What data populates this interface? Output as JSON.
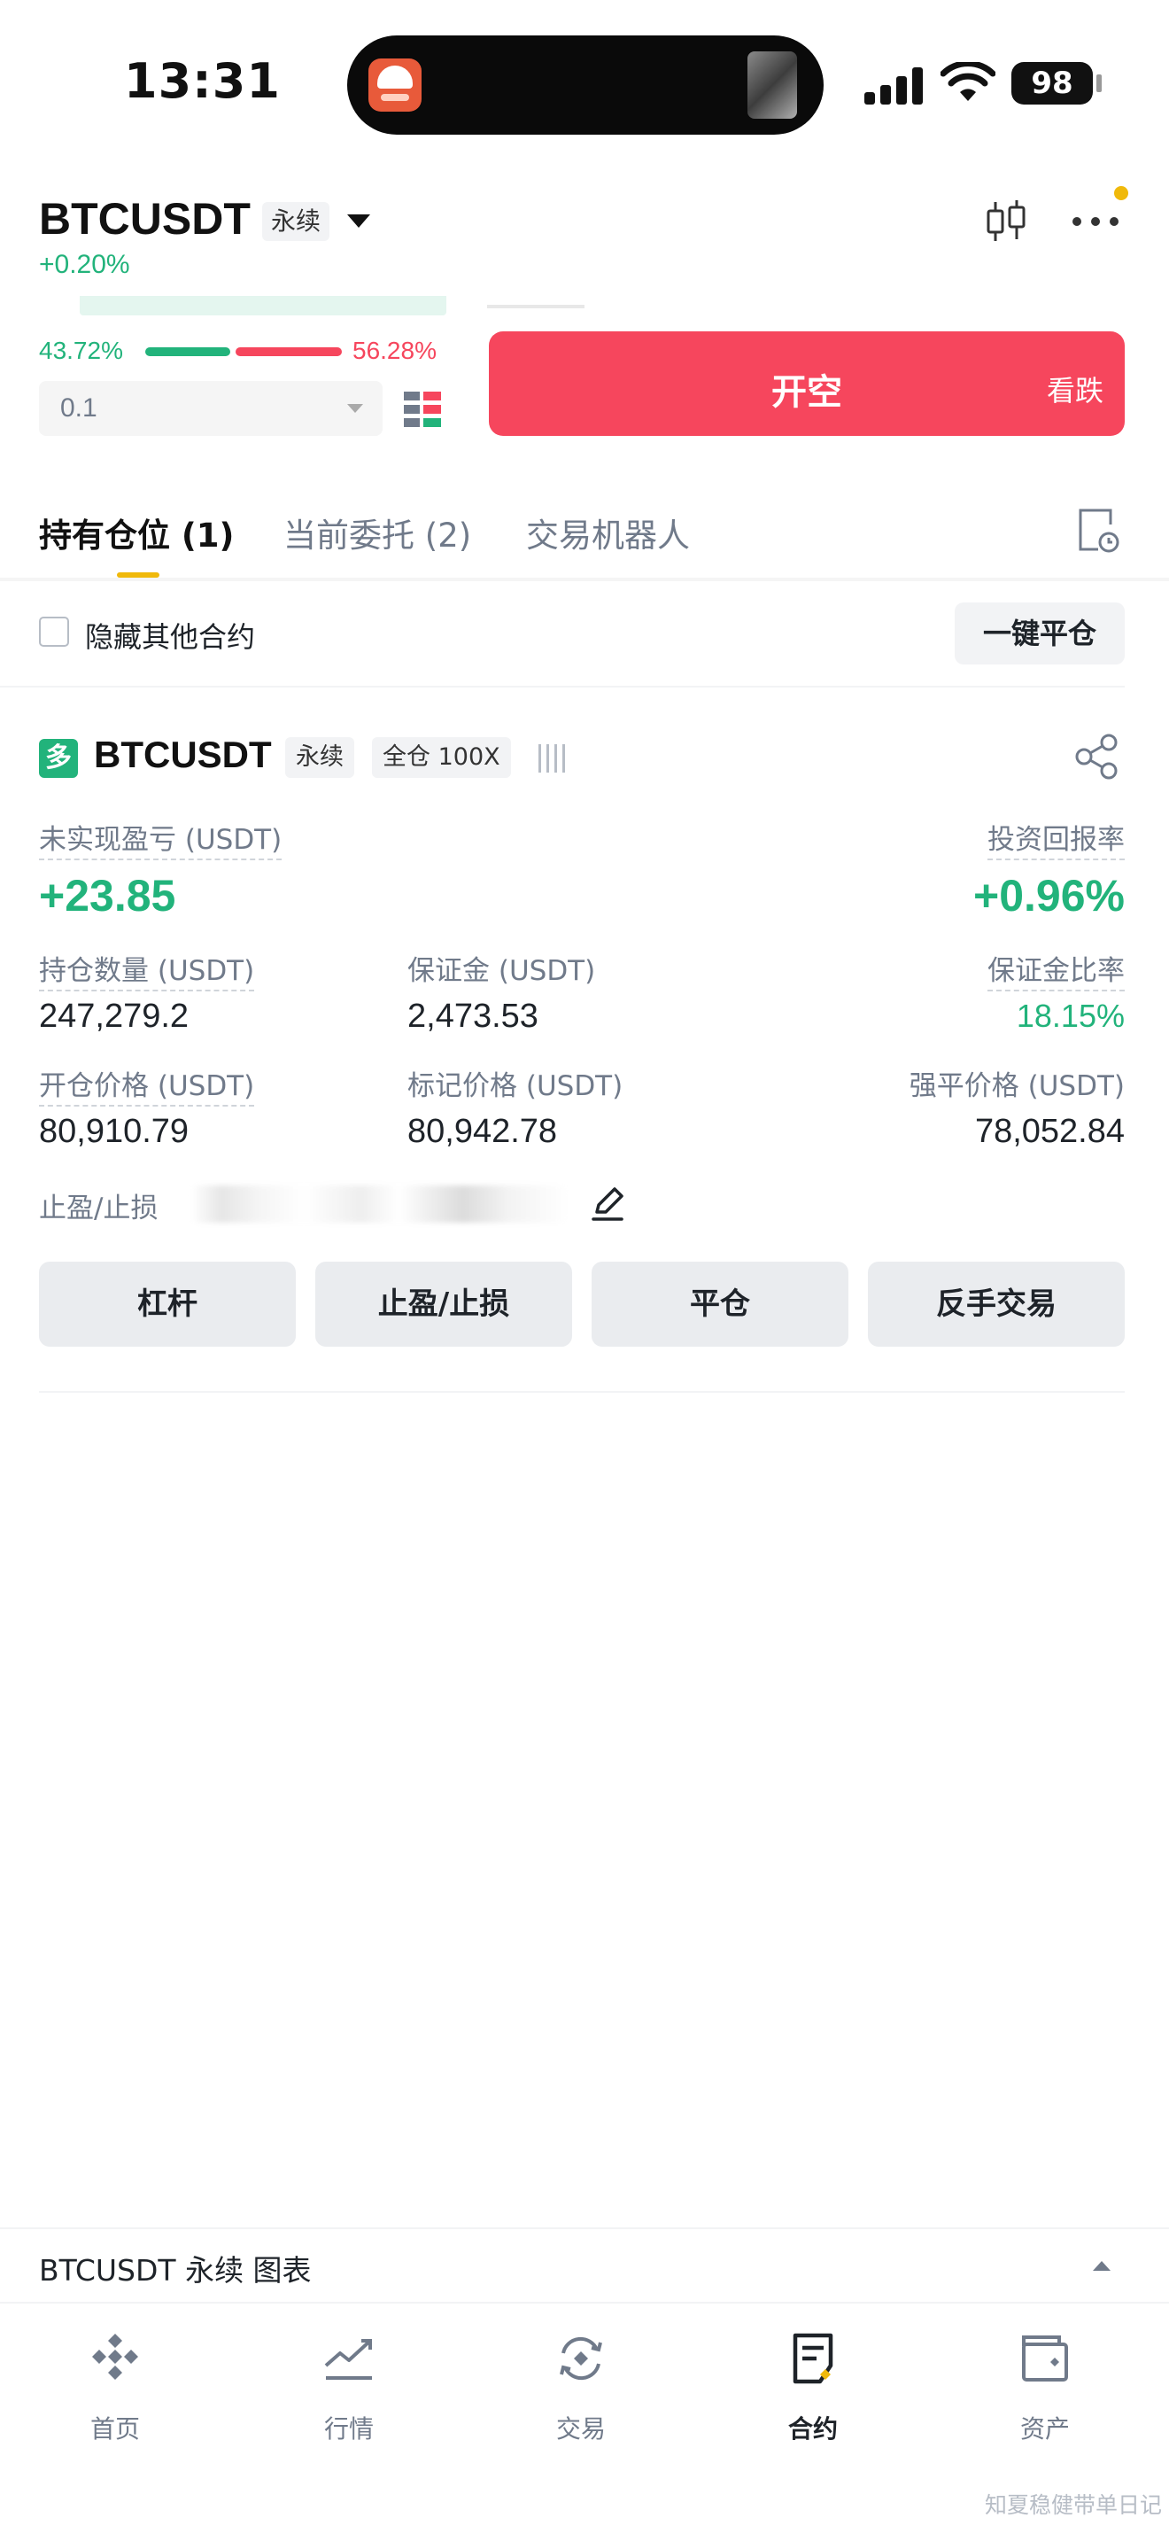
{
  "status_bar": {
    "time": "13:31",
    "battery": "98"
  },
  "header": {
    "symbol": "BTCUSDT",
    "contract_type": "永续",
    "change": "+0.20%",
    "icons": [
      "candlestick-icon",
      "more-icon"
    ],
    "notification_dot_color": "#f0b90b"
  },
  "order_panel": {
    "buy_ratio": "43.72%",
    "sell_ratio": "56.28%",
    "buy_ratio_value": 43.72,
    "sell_ratio_value": 56.28,
    "quantity": "0.1",
    "short_button": {
      "label": "开空",
      "sublabel": "看跌",
      "color": "#f6465d"
    }
  },
  "tabs": [
    {
      "label": "持有仓位",
      "count": "(1)",
      "active": true
    },
    {
      "label": "当前委托",
      "count": "(2)",
      "active": false
    },
    {
      "label": "交易机器人",
      "count": "",
      "active": false
    }
  ],
  "filter": {
    "hide_other_label": "隐藏其他合约",
    "hide_other_checked": false,
    "close_all_label": "一键平仓"
  },
  "position": {
    "side_badge": "多",
    "symbol": "BTCUSDT",
    "contract_type": "永续",
    "margin_mode": "全仓 100X",
    "unrealized_pnl_label": "未实现盈亏 (USDT)",
    "unrealized_pnl": "+23.85",
    "roi_label": "投资回报率",
    "roi": "+0.96%",
    "size_label": "持仓数量 (USDT)",
    "size": "247,279.2",
    "margin_label": "保证金 (USDT)",
    "margin": "2,473.53",
    "margin_ratio_label": "保证金比率",
    "margin_ratio": "18.15%",
    "entry_price_label": "开仓价格 (USDT)",
    "entry_price": "80,910.79",
    "mark_price_label": "标记价格 (USDT)",
    "mark_price": "80,942.78",
    "liq_price_label": "强平价格 (USDT)",
    "liq_price": "78,052.84",
    "tpsl_label": "止盈/止损",
    "actions": [
      "杠杆",
      "止盈/止损",
      "平仓",
      "反手交易"
    ]
  },
  "chart_bar": {
    "label": "BTCUSDT 永续 图表"
  },
  "bottom_nav": [
    {
      "label": "首页",
      "icon": "home-logo-icon",
      "active": false
    },
    {
      "label": "行情",
      "icon": "markets-icon",
      "active": false
    },
    {
      "label": "交易",
      "icon": "trade-icon",
      "active": false
    },
    {
      "label": "合约",
      "icon": "futures-icon",
      "active": true
    },
    {
      "label": "资产",
      "icon": "wallet-icon",
      "active": false
    }
  ],
  "watermark": "知夏稳健带单日记",
  "colors": {
    "up": "#22b37b",
    "down": "#f6465d",
    "accent": "#f0b90b",
    "text": "#1e2329",
    "muted": "#707a8a"
  }
}
